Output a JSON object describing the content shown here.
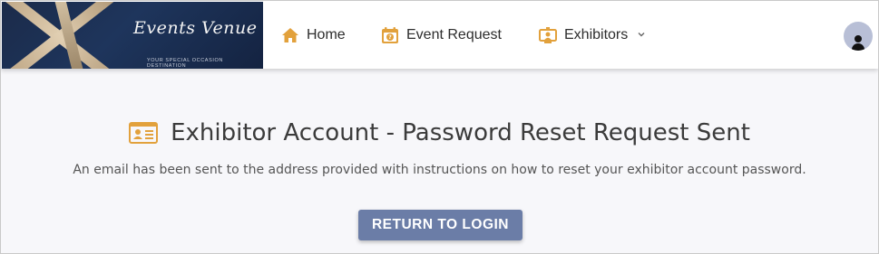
{
  "brand": {
    "name": "Events Venue",
    "tagline": "YOUR SPECIAL OCCASION DESTINATION"
  },
  "nav": {
    "items": [
      {
        "label": "Home",
        "icon": "home-icon"
      },
      {
        "label": "Event Request",
        "icon": "calendar-question-icon"
      },
      {
        "label": "Exhibitors",
        "icon": "exhibitor-booth-icon",
        "has_dropdown": true
      }
    ],
    "user": {
      "icon": "user-avatar-icon"
    }
  },
  "main": {
    "title": "Exhibitor Account - Password Reset Request Sent",
    "title_icon": "id-card-icon",
    "message": "An email has been sent to the address provided with instructions on how to reset your exhibitor account password.",
    "button_label": "RETURN TO LOGIN"
  },
  "colors": {
    "accent_icon": "#e2a13c",
    "button": "#6b7da7",
    "header_bg": "#ffffff",
    "page_bg": "#f7f7fa"
  }
}
